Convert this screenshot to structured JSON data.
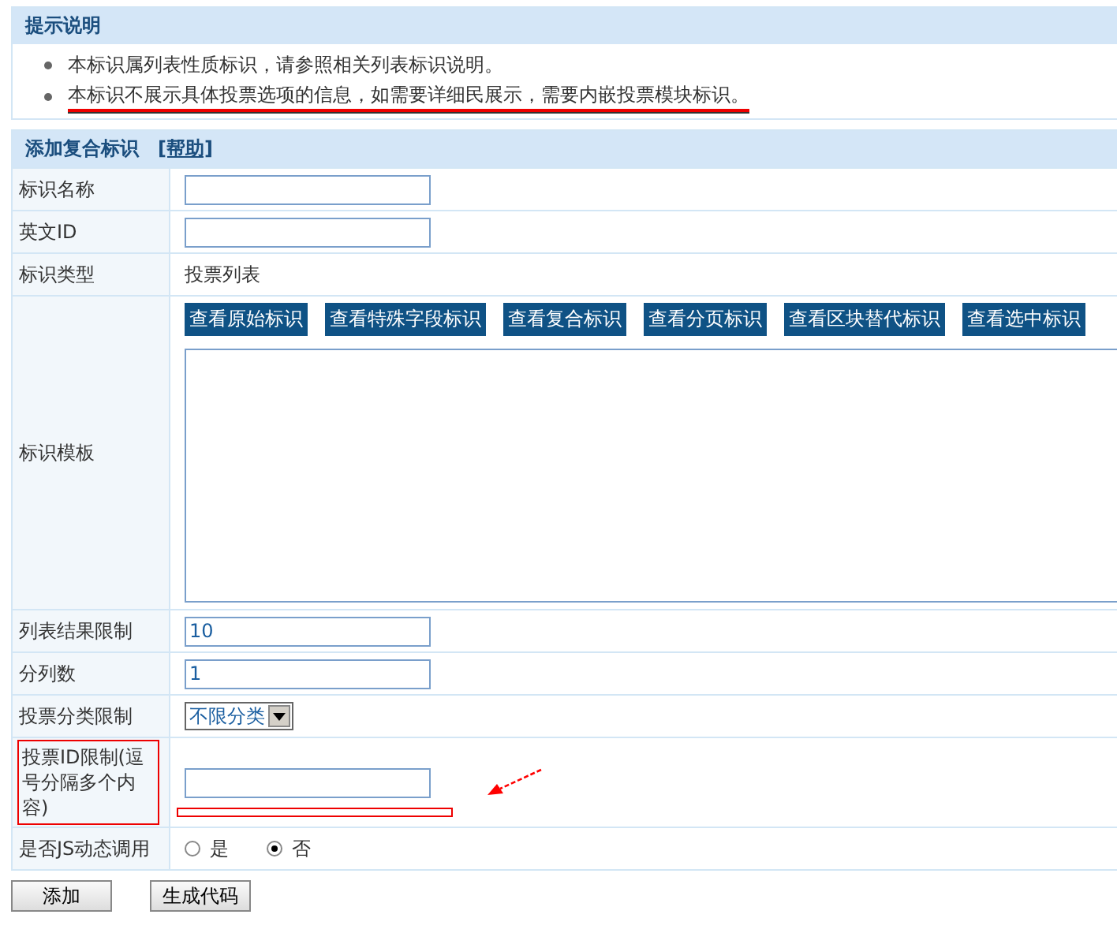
{
  "tips": {
    "title": "提示说明",
    "items": [
      {
        "text": "本标识属列表性质标识，请参照相关列表标识说明。",
        "underlined": false
      },
      {
        "text": "本标识不展示具体投票选项的信息，如需要详细民展示，需要内嵌投票模块标识。",
        "underlined": true
      }
    ]
  },
  "form": {
    "title": "添加复合标识",
    "help_link": "[帮助]",
    "rows": [
      {
        "kind": "input",
        "label": "标识名称",
        "value": ""
      },
      {
        "kind": "input",
        "label": "英文ID",
        "value": ""
      },
      {
        "kind": "static",
        "label": "标识类型",
        "value": "投票列表"
      },
      {
        "kind": "template",
        "label": "标识模板",
        "buttons": [
          "查看原始标识",
          "查看特殊字段标识",
          "查看复合标识",
          "查看分页标识",
          "查看区块替代标识",
          "查看选中标识"
        ],
        "value": ""
      },
      {
        "kind": "input",
        "label": "列表结果限制",
        "value": "10"
      },
      {
        "kind": "input",
        "label": "分列数",
        "value": "1"
      },
      {
        "kind": "select",
        "label": "投票分类限制",
        "value": "不限分类"
      },
      {
        "kind": "input",
        "label": "投票ID限制(逗号分隔多个内容)",
        "value": "",
        "highlighted": true
      },
      {
        "kind": "radio",
        "label": "是否JS动态调用",
        "options": [
          {
            "label": "是",
            "selected": false
          },
          {
            "label": "否",
            "selected": true
          }
        ]
      }
    ]
  },
  "buttons": [
    "添加",
    "生成代码"
  ]
}
